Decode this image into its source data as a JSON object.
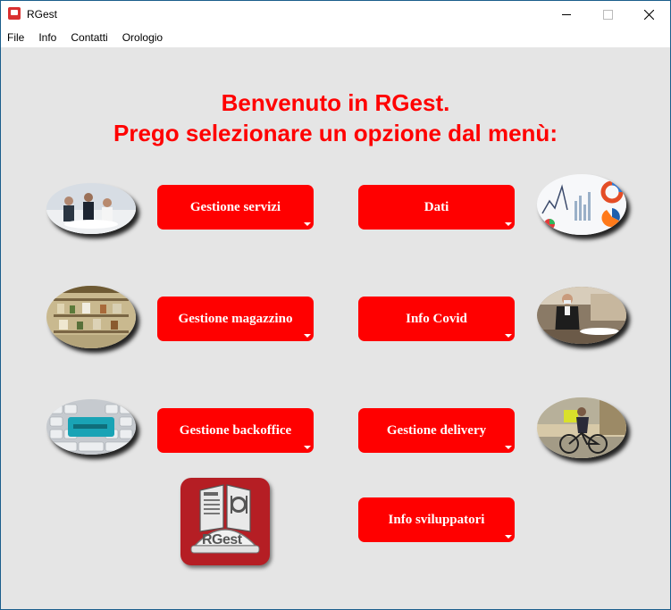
{
  "window": {
    "title": "RGest"
  },
  "menu": {
    "items": [
      "File",
      "Info",
      "Contatti",
      "Orologio"
    ]
  },
  "heading": {
    "line1": "Benvenuto in RGest.",
    "line2": "Prego selezionare un opzione dal menù:"
  },
  "buttons": {
    "gestione_servizi": "Gestione servizi",
    "dati": "Dati",
    "gestione_magazzino": "Gestione magazzino",
    "info_covid": "Info Covid",
    "gestione_backoffice": "Gestione backoffice",
    "gestione_delivery": "Gestione delivery",
    "info_sviluppatori": "Info sviluppatori"
  },
  "logo": {
    "text": "RGest"
  },
  "colors": {
    "accent": "#ff0000",
    "logo_bg": "#b51e24",
    "window_bg": "#e5e5e5"
  },
  "icons": [
    "waiter-staff-image",
    "charts-image",
    "warehouse-image",
    "covid-waiter-image",
    "keyboard-image",
    "delivery-bike-image",
    "rgest-logo"
  ]
}
